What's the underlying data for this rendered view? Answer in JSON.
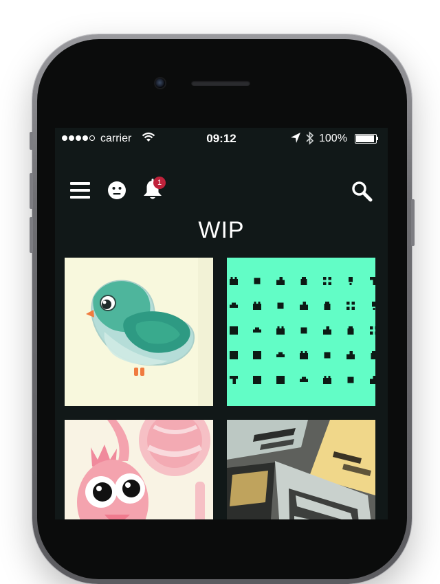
{
  "status_bar": {
    "carrier": "carrier",
    "time": "09:12",
    "battery": "100%",
    "battery_level": 1.0,
    "signal_bars_filled": 4,
    "signal_bars_total": 5
  },
  "nav": {
    "menu_icon": "hamburger-menu-icon",
    "profile_icon": "face-icon",
    "notifications_icon": "bell-icon",
    "notification_count": "1",
    "search_icon": "search-icon"
  },
  "page": {
    "title": "WIP"
  },
  "gallery": {
    "items": [
      {
        "subject": "green-bird-illustration",
        "background": "#f8f8dd"
      },
      {
        "subject": "icon-glyph-grid",
        "background": "#62fdc6"
      },
      {
        "subject": "pink-bird-illustration",
        "background": "#f9f3e4"
      },
      {
        "subject": "printed-cards-photo",
        "background": "#3b3f3c"
      }
    ]
  },
  "colors": {
    "screen_bg": "#111818",
    "badge": "#c0223b",
    "icon_tile_bg": "#62fdc6"
  }
}
